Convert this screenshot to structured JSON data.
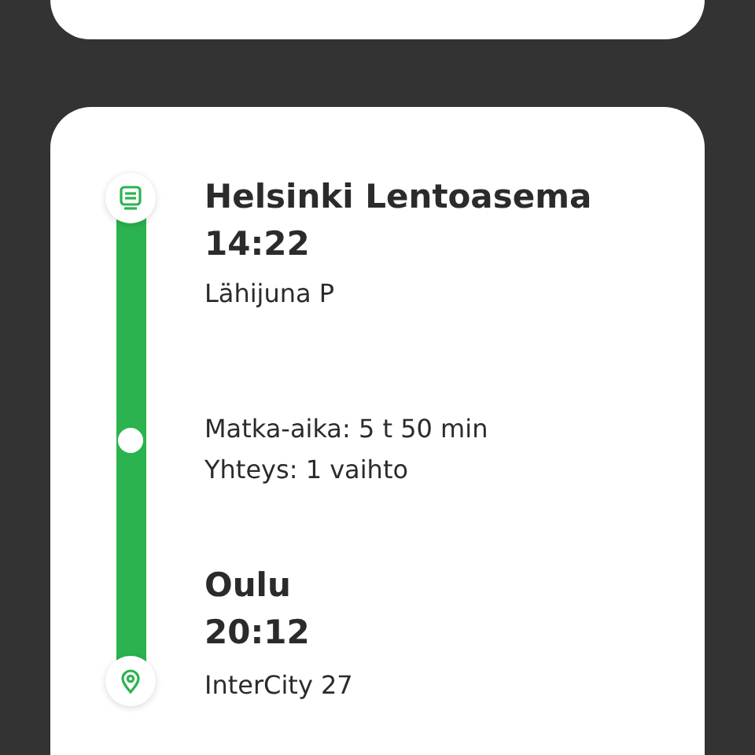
{
  "route": {
    "origin": {
      "station": "Helsinki Lentoasema",
      "time": "14:22",
      "train": "Lähijuna P"
    },
    "summary": [
      "Matka-aika: 5 t 50 min",
      "Yhteys: 1 vaihto"
    ],
    "destination": {
      "station": "Oulu",
      "time": "20:12",
      "train": "InterCity 27"
    }
  }
}
